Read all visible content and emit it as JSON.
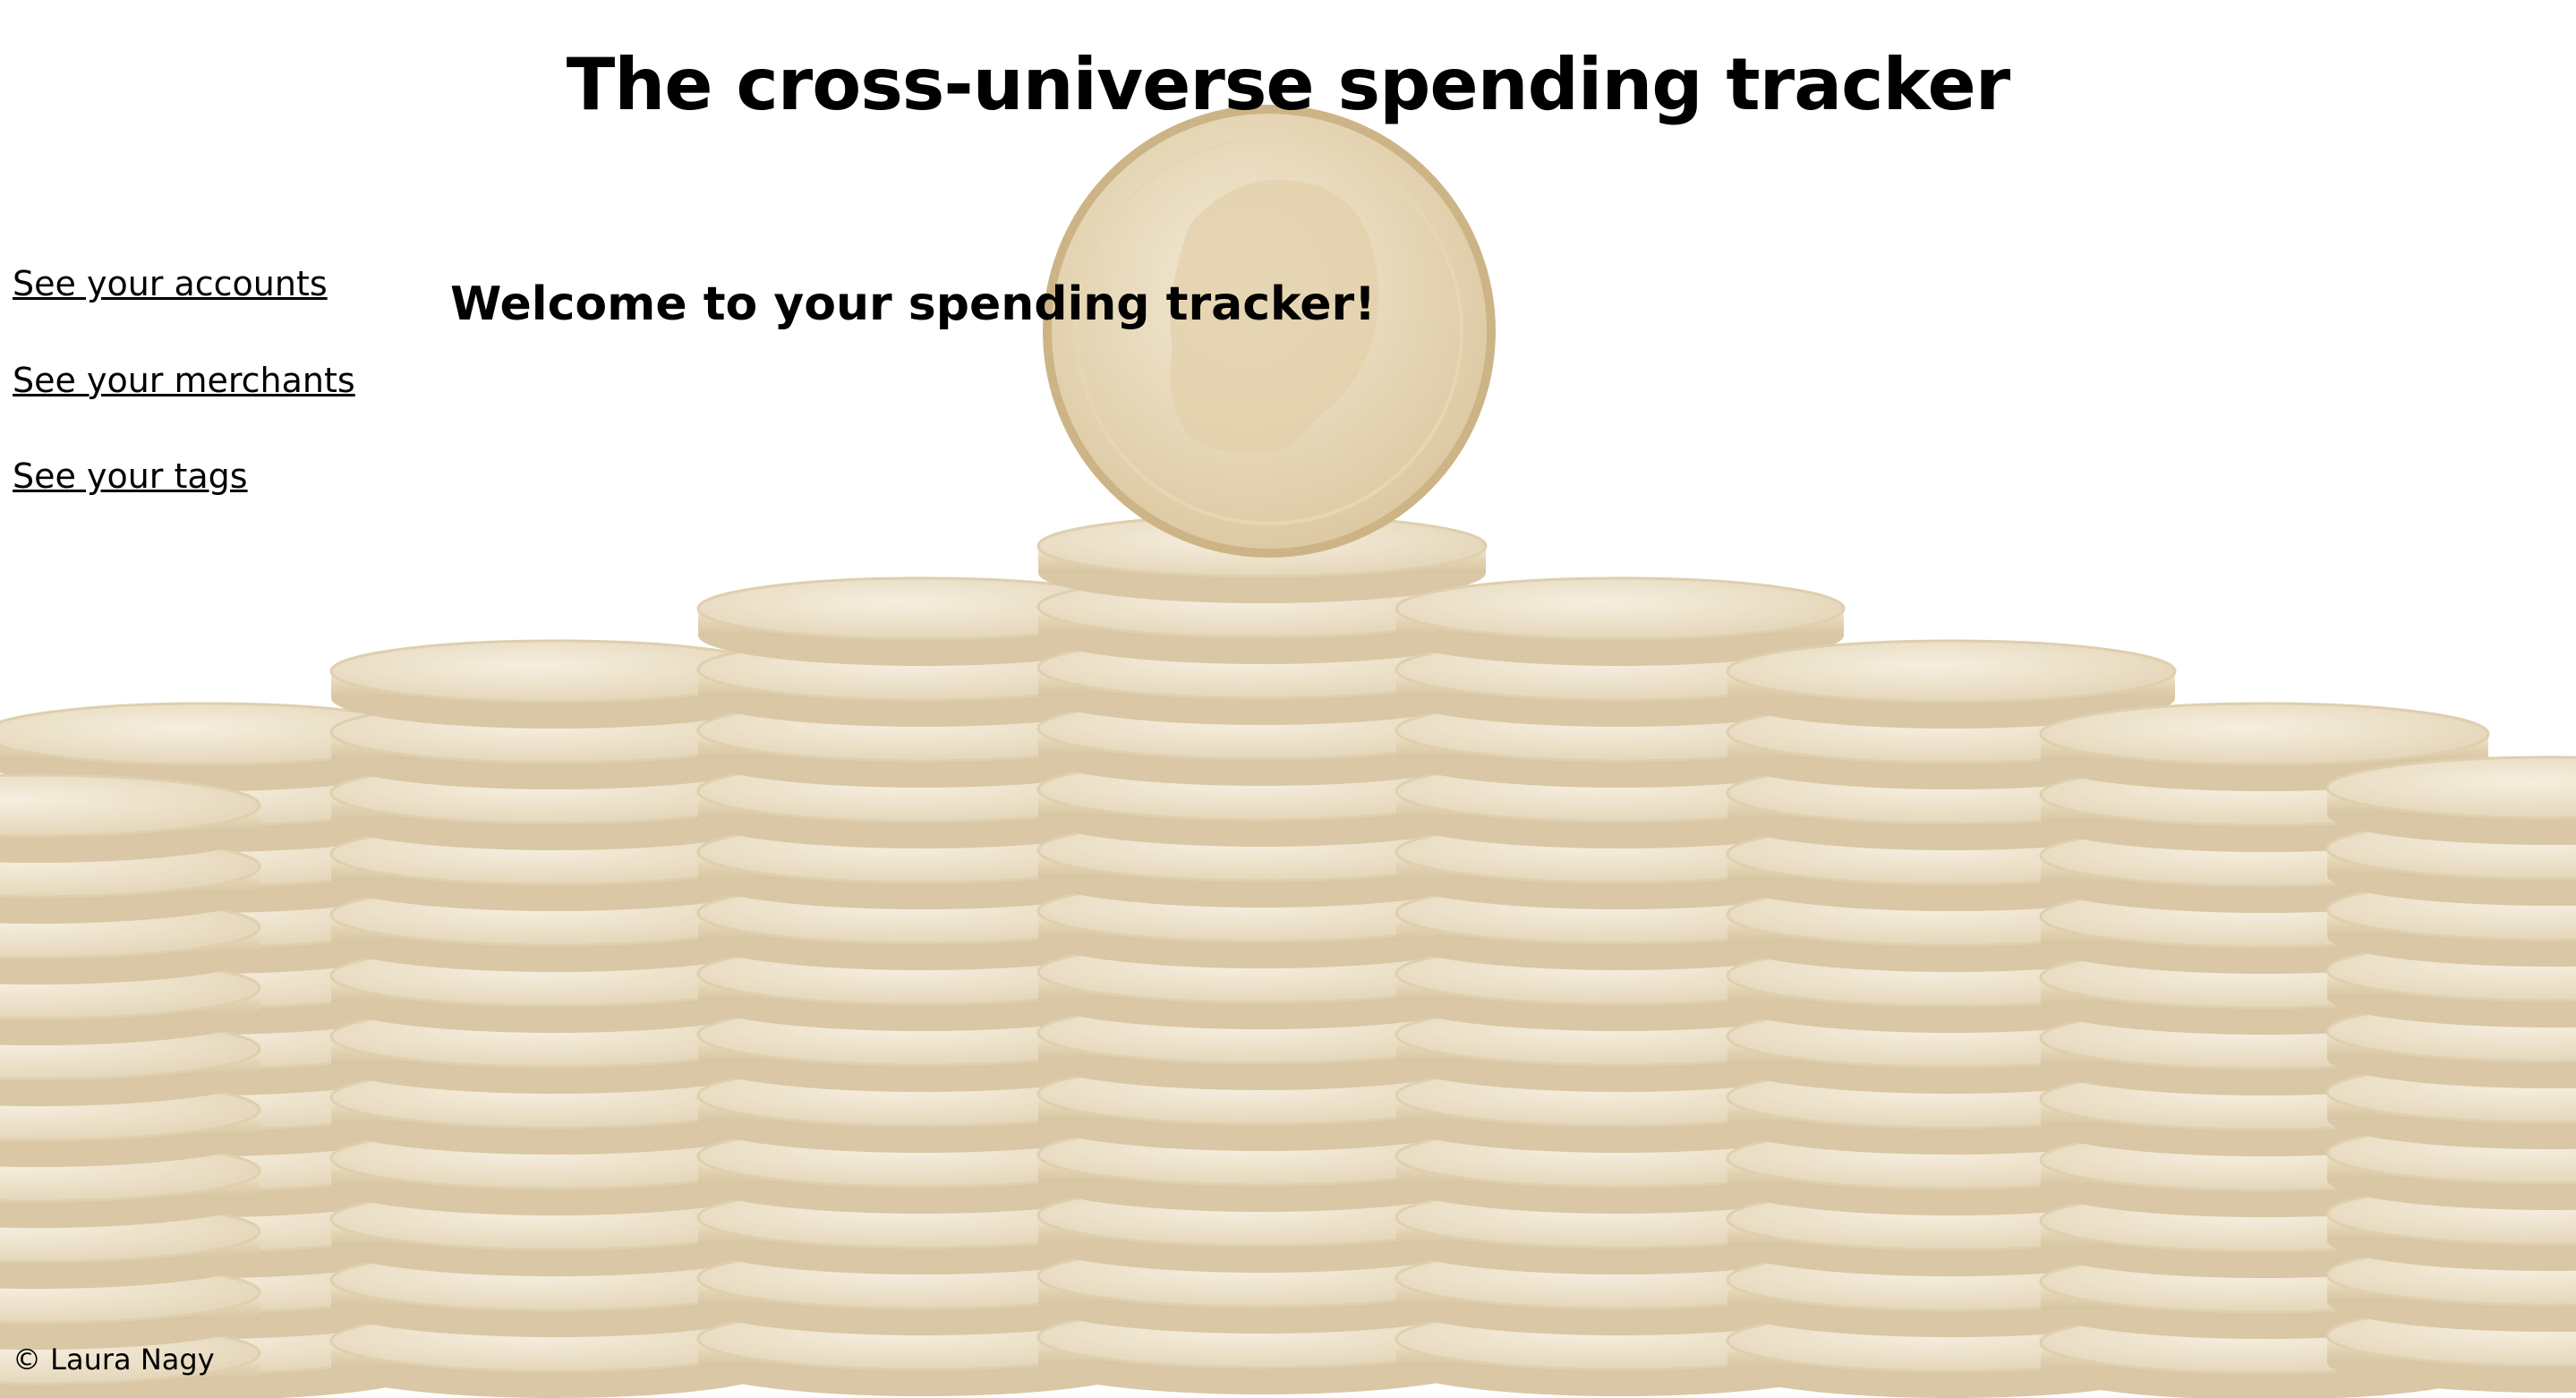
{
  "header": {
    "title": "The cross-universe spending tracker"
  },
  "nav": {
    "items": [
      {
        "label": "See your accounts"
      },
      {
        "label": "See your merchants"
      },
      {
        "label": "See your tags"
      }
    ]
  },
  "main": {
    "heading": "Welcome to your spending tracker!"
  },
  "footer": {
    "copyright": "© Laura Nagy"
  },
  "background": {
    "icon": "coin-stack-image",
    "coin_color": "#d8c39a"
  }
}
